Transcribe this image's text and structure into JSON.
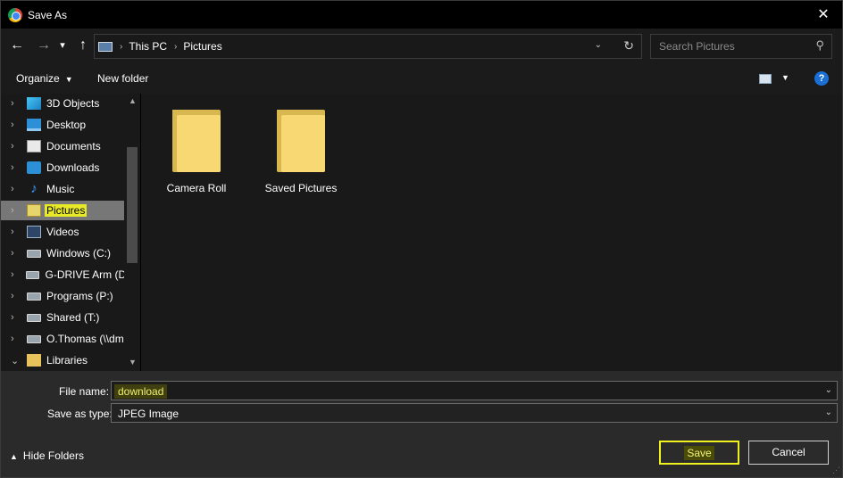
{
  "window": {
    "title": "Save As",
    "close_glyph": "✕"
  },
  "nav": {
    "back_glyph": "←",
    "forward_glyph": "→",
    "recent_glyph": "▾",
    "up_glyph": "↑",
    "breadcrumb": [
      "This PC",
      "Pictures"
    ],
    "dropdown_glyph": "⌄",
    "refresh_glyph": "↻"
  },
  "search": {
    "placeholder": "Search Pictures",
    "glyph": "⚲"
  },
  "toolbar": {
    "organize_label": "Organize",
    "new_folder_label": "New folder",
    "help_glyph": "?"
  },
  "tree": {
    "items": [
      {
        "label": "3D Objects",
        "icon": "3d-objects-icon",
        "selected": false
      },
      {
        "label": "Desktop",
        "icon": "desktop-icon",
        "selected": false
      },
      {
        "label": "Documents",
        "icon": "documents-icon",
        "selected": false
      },
      {
        "label": "Downloads",
        "icon": "downloads-icon",
        "selected": false
      },
      {
        "label": "Music",
        "icon": "music-icon",
        "selected": false
      },
      {
        "label": "Pictures",
        "icon": "pictures-icon",
        "selected": true
      },
      {
        "label": "Videos",
        "icon": "videos-icon",
        "selected": false
      },
      {
        "label": "Windows (C:)",
        "icon": "drive-icon",
        "selected": false
      },
      {
        "label": "G-DRIVE Arm (D:",
        "icon": "drive-icon",
        "selected": false
      },
      {
        "label": "Programs (P:)",
        "icon": "network-drive-icon",
        "selected": false
      },
      {
        "label": "Shared (T:)",
        "icon": "network-drive-icon",
        "selected": false
      },
      {
        "label": "O.Thomas (\\\\dm",
        "icon": "network-drive-icon",
        "selected": false
      },
      {
        "label": "Libraries",
        "icon": "libraries-icon",
        "selected": false
      }
    ],
    "chevron_glyph": "›",
    "expanded_glyph": "⌄"
  },
  "folders": [
    {
      "name": "Camera Roll"
    },
    {
      "name": "Saved Pictures"
    }
  ],
  "form": {
    "file_name_label": "File name:",
    "file_name_value": "download",
    "save_type_label": "Save as type:",
    "save_type_value": "JPEG Image",
    "caret_glyph": "⌄"
  },
  "footer": {
    "hide_folders_label": "Hide Folders",
    "save_label": "Save",
    "cancel_label": "Cancel"
  },
  "colors": {
    "highlight": "#e8ea29",
    "selection": "#777777",
    "background": "#191919",
    "panel": "#2a2a2a"
  }
}
